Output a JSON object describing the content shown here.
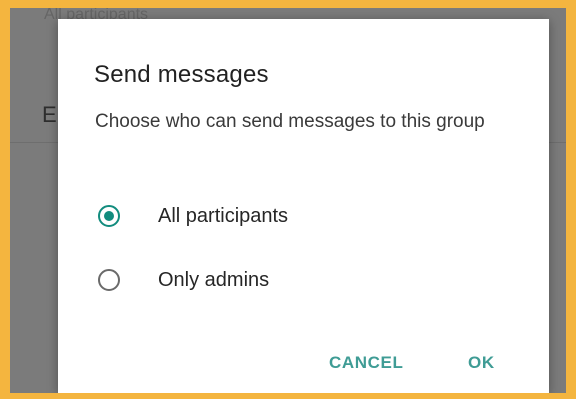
{
  "background": {
    "partial_text_top": "All participants",
    "partial_text_row": "E"
  },
  "dialog": {
    "title": "Send messages",
    "description": "Choose who can send messages to this group",
    "options": [
      {
        "label": "All participants",
        "selected": true
      },
      {
        "label": "Only admins",
        "selected": false
      }
    ],
    "cancel_label": "CANCEL",
    "ok_label": "OK"
  },
  "colors": {
    "accent": "#128c7e",
    "button_text": "#3f9c95",
    "border_highlight": "#f4b53f"
  }
}
